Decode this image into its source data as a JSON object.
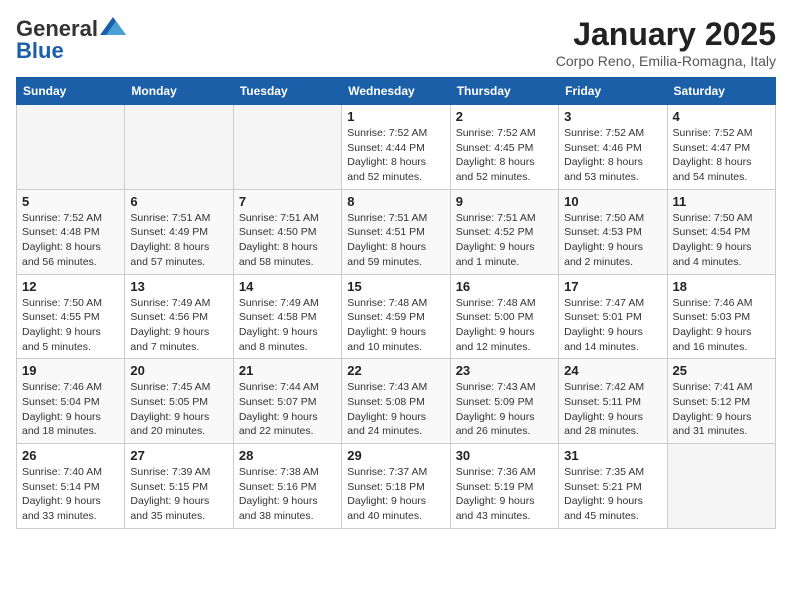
{
  "header": {
    "logo_general": "General",
    "logo_blue": "Blue",
    "month_title": "January 2025",
    "subtitle": "Corpo Reno, Emilia-Romagna, Italy"
  },
  "days_of_week": [
    "Sunday",
    "Monday",
    "Tuesday",
    "Wednesday",
    "Thursday",
    "Friday",
    "Saturday"
  ],
  "weeks": [
    [
      {
        "day": "",
        "sunrise": "",
        "sunset": "",
        "daylight": ""
      },
      {
        "day": "",
        "sunrise": "",
        "sunset": "",
        "daylight": ""
      },
      {
        "day": "",
        "sunrise": "",
        "sunset": "",
        "daylight": ""
      },
      {
        "day": "1",
        "sunrise": "Sunrise: 7:52 AM",
        "sunset": "Sunset: 4:44 PM",
        "daylight": "Daylight: 8 hours and 52 minutes."
      },
      {
        "day": "2",
        "sunrise": "Sunrise: 7:52 AM",
        "sunset": "Sunset: 4:45 PM",
        "daylight": "Daylight: 8 hours and 52 minutes."
      },
      {
        "day": "3",
        "sunrise": "Sunrise: 7:52 AM",
        "sunset": "Sunset: 4:46 PM",
        "daylight": "Daylight: 8 hours and 53 minutes."
      },
      {
        "day": "4",
        "sunrise": "Sunrise: 7:52 AM",
        "sunset": "Sunset: 4:47 PM",
        "daylight": "Daylight: 8 hours and 54 minutes."
      }
    ],
    [
      {
        "day": "5",
        "sunrise": "Sunrise: 7:52 AM",
        "sunset": "Sunset: 4:48 PM",
        "daylight": "Daylight: 8 hours and 56 minutes."
      },
      {
        "day": "6",
        "sunrise": "Sunrise: 7:51 AM",
        "sunset": "Sunset: 4:49 PM",
        "daylight": "Daylight: 8 hours and 57 minutes."
      },
      {
        "day": "7",
        "sunrise": "Sunrise: 7:51 AM",
        "sunset": "Sunset: 4:50 PM",
        "daylight": "Daylight: 8 hours and 58 minutes."
      },
      {
        "day": "8",
        "sunrise": "Sunrise: 7:51 AM",
        "sunset": "Sunset: 4:51 PM",
        "daylight": "Daylight: 8 hours and 59 minutes."
      },
      {
        "day": "9",
        "sunrise": "Sunrise: 7:51 AM",
        "sunset": "Sunset: 4:52 PM",
        "daylight": "Daylight: 9 hours and 1 minute."
      },
      {
        "day": "10",
        "sunrise": "Sunrise: 7:50 AM",
        "sunset": "Sunset: 4:53 PM",
        "daylight": "Daylight: 9 hours and 2 minutes."
      },
      {
        "day": "11",
        "sunrise": "Sunrise: 7:50 AM",
        "sunset": "Sunset: 4:54 PM",
        "daylight": "Daylight: 9 hours and 4 minutes."
      }
    ],
    [
      {
        "day": "12",
        "sunrise": "Sunrise: 7:50 AM",
        "sunset": "Sunset: 4:55 PM",
        "daylight": "Daylight: 9 hours and 5 minutes."
      },
      {
        "day": "13",
        "sunrise": "Sunrise: 7:49 AM",
        "sunset": "Sunset: 4:56 PM",
        "daylight": "Daylight: 9 hours and 7 minutes."
      },
      {
        "day": "14",
        "sunrise": "Sunrise: 7:49 AM",
        "sunset": "Sunset: 4:58 PM",
        "daylight": "Daylight: 9 hours and 8 minutes."
      },
      {
        "day": "15",
        "sunrise": "Sunrise: 7:48 AM",
        "sunset": "Sunset: 4:59 PM",
        "daylight": "Daylight: 9 hours and 10 minutes."
      },
      {
        "day": "16",
        "sunrise": "Sunrise: 7:48 AM",
        "sunset": "Sunset: 5:00 PM",
        "daylight": "Daylight: 9 hours and 12 minutes."
      },
      {
        "day": "17",
        "sunrise": "Sunrise: 7:47 AM",
        "sunset": "Sunset: 5:01 PM",
        "daylight": "Daylight: 9 hours and 14 minutes."
      },
      {
        "day": "18",
        "sunrise": "Sunrise: 7:46 AM",
        "sunset": "Sunset: 5:03 PM",
        "daylight": "Daylight: 9 hours and 16 minutes."
      }
    ],
    [
      {
        "day": "19",
        "sunrise": "Sunrise: 7:46 AM",
        "sunset": "Sunset: 5:04 PM",
        "daylight": "Daylight: 9 hours and 18 minutes."
      },
      {
        "day": "20",
        "sunrise": "Sunrise: 7:45 AM",
        "sunset": "Sunset: 5:05 PM",
        "daylight": "Daylight: 9 hours and 20 minutes."
      },
      {
        "day": "21",
        "sunrise": "Sunrise: 7:44 AM",
        "sunset": "Sunset: 5:07 PM",
        "daylight": "Daylight: 9 hours and 22 minutes."
      },
      {
        "day": "22",
        "sunrise": "Sunrise: 7:43 AM",
        "sunset": "Sunset: 5:08 PM",
        "daylight": "Daylight: 9 hours and 24 minutes."
      },
      {
        "day": "23",
        "sunrise": "Sunrise: 7:43 AM",
        "sunset": "Sunset: 5:09 PM",
        "daylight": "Daylight: 9 hours and 26 minutes."
      },
      {
        "day": "24",
        "sunrise": "Sunrise: 7:42 AM",
        "sunset": "Sunset: 5:11 PM",
        "daylight": "Daylight: 9 hours and 28 minutes."
      },
      {
        "day": "25",
        "sunrise": "Sunrise: 7:41 AM",
        "sunset": "Sunset: 5:12 PM",
        "daylight": "Daylight: 9 hours and 31 minutes."
      }
    ],
    [
      {
        "day": "26",
        "sunrise": "Sunrise: 7:40 AM",
        "sunset": "Sunset: 5:14 PM",
        "daylight": "Daylight: 9 hours and 33 minutes."
      },
      {
        "day": "27",
        "sunrise": "Sunrise: 7:39 AM",
        "sunset": "Sunset: 5:15 PM",
        "daylight": "Daylight: 9 hours and 35 minutes."
      },
      {
        "day": "28",
        "sunrise": "Sunrise: 7:38 AM",
        "sunset": "Sunset: 5:16 PM",
        "daylight": "Daylight: 9 hours and 38 minutes."
      },
      {
        "day": "29",
        "sunrise": "Sunrise: 7:37 AM",
        "sunset": "Sunset: 5:18 PM",
        "daylight": "Daylight: 9 hours and 40 minutes."
      },
      {
        "day": "30",
        "sunrise": "Sunrise: 7:36 AM",
        "sunset": "Sunset: 5:19 PM",
        "daylight": "Daylight: 9 hours and 43 minutes."
      },
      {
        "day": "31",
        "sunrise": "Sunrise: 7:35 AM",
        "sunset": "Sunset: 5:21 PM",
        "daylight": "Daylight: 9 hours and 45 minutes."
      },
      {
        "day": "",
        "sunrise": "",
        "sunset": "",
        "daylight": ""
      }
    ]
  ]
}
